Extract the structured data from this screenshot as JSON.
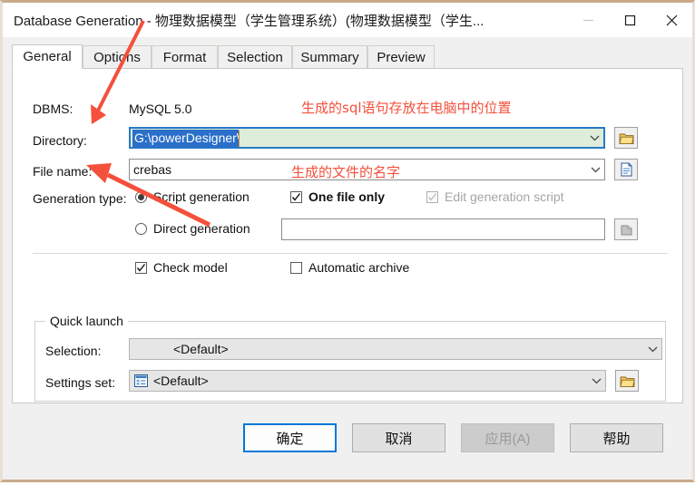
{
  "window": {
    "title": "Database Generation - 物理数据模型（学生管理系统）(物理数据模型（学生...",
    "minimize_label": "minimize",
    "maximize_label": "maximize",
    "close_label": "close"
  },
  "tabs": [
    {
      "label": "General",
      "active": true
    },
    {
      "label": "Options",
      "active": false
    },
    {
      "label": "Format",
      "active": false
    },
    {
      "label": "Selection",
      "active": false
    },
    {
      "label": "Summary",
      "active": false
    },
    {
      "label": "Preview",
      "active": false
    }
  ],
  "form": {
    "dbms_label": "DBMS:",
    "dbms_value": "MySQL 5.0",
    "directory_label": "Directory:",
    "directory_value": "G:\\powerDesigner\\",
    "filename_label": "File name:",
    "filename_value": "crebas",
    "generation_type_label": "Generation type:",
    "script_generation_label": "Script generation",
    "direct_generation_label": "Direct generation",
    "direct_generation_value": "",
    "one_file_only_label": "One file only",
    "edit_generation_script_label": "Edit generation script",
    "check_model_label": "Check model",
    "automatic_archive_label": "Automatic archive"
  },
  "quick_launch": {
    "group_title": "Quick launch",
    "selection_label": "Selection:",
    "selection_value": "<Default>",
    "settings_set_label": "Settings set:",
    "settings_set_value": "<Default>"
  },
  "footer": {
    "ok_label": "确定",
    "cancel_label": "取消",
    "apply_label": "应用(A)",
    "help_label": "帮助"
  },
  "annotations": {
    "directory_note": "生成的sql语句存放在电脑中的位置",
    "filename_note": "生成的文件的名字"
  },
  "colors": {
    "accent": "#0078d7",
    "selection": "#2a6fc9",
    "field_highlight": "#ddedd9",
    "annotation": "#f4503c",
    "window_border": "#c9ab8a"
  }
}
